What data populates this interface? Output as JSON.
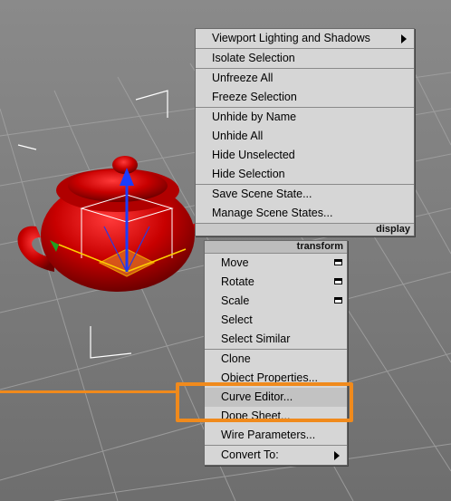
{
  "display_menu": {
    "items": [
      {
        "label": "Viewport Lighting and Shadows"
      },
      {
        "label": "Isolate Selection"
      },
      {
        "label": "Unfreeze All"
      },
      {
        "label": "Freeze Selection"
      },
      {
        "label": "Unhide by Name"
      },
      {
        "label": "Unhide All"
      },
      {
        "label": "Hide Unselected"
      },
      {
        "label": "Hide Selection"
      },
      {
        "label": "Save Scene State..."
      },
      {
        "label": "Manage Scene States..."
      }
    ],
    "quad_label": "display"
  },
  "transform_menu": {
    "quad_label": "transform",
    "items": [
      {
        "label": "Move"
      },
      {
        "label": "Rotate"
      },
      {
        "label": "Scale"
      },
      {
        "label": "Select"
      },
      {
        "label": "Select Similar"
      },
      {
        "label": "Clone"
      },
      {
        "label": "Object Properties..."
      },
      {
        "label": "Curve Editor..."
      },
      {
        "label": "Dope Sheet..."
      },
      {
        "label": "Wire Parameters..."
      },
      {
        "label": "Convert To:"
      }
    ]
  },
  "colors": {
    "highlight": "#f08a1c",
    "teapot": "#d40000",
    "menu_bg": "#d6d6d6",
    "viewport_bg": "#7d7d7d"
  }
}
